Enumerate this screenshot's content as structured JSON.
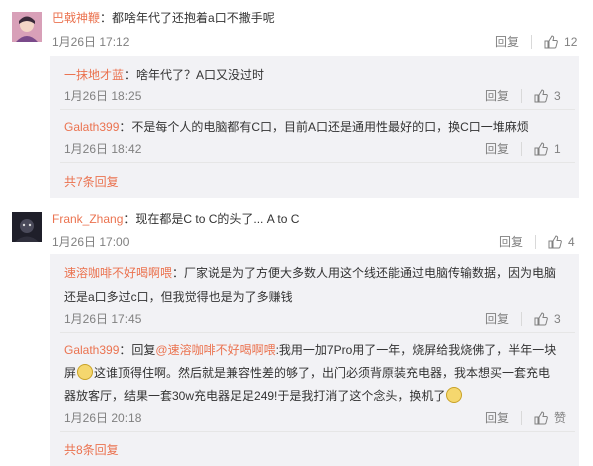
{
  "comments": [
    {
      "name": "巴戟神鞭",
      "text": "：都啥年代了还抱着a口不撒手呢",
      "time": "1月26日 17:12",
      "reply_label": "回复",
      "likes": "12",
      "replies": [
        {
          "name": "一抹地才蓝",
          "text": "：啥年代了？A口又没过时",
          "time": "1月26日 18:25",
          "reply_label": "回复",
          "likes": "3"
        },
        {
          "name": "Galath399",
          "text": "：不是每个人的电脑都有C口，目前A口还是通用性最好的口，换C口一堆麻烦",
          "time": "1月26日 18:42",
          "reply_label": "回复",
          "likes": "1"
        }
      ],
      "more_label": "共7条回复"
    },
    {
      "name": "Frank_Zhang",
      "text": "：现在都是C to C的头了... A to C",
      "time": "1月26日 17:00",
      "reply_label": "回复",
      "likes": "4",
      "replies": [
        {
          "name": "速溶咖啡不好喝啊喂",
          "text_line1": "：厂家说是为了方便大多数人用这个线还能通过电脑传输数据，因为电脑",
          "text_line2": "还是a口多过c口，但我觉得也是为了多赚钱",
          "time": "1月26日 17:45",
          "reply_label": "回复",
          "likes": "3"
        },
        {
          "name": "Galath399",
          "text_prefix": "：回复",
          "mention": "@速溶咖啡不好喝啊喂",
          "text_line1": ":我用一加7Pro用了一年，烧屏给我烧佛了，半年一块",
          "text_line2a": "屏",
          "text_line2b": "这谁顶得住啊。然后就是兼容性差的够了，出门必须背原装充电器，我本想买一套充电",
          "text_line3": "器放客厅，结果一套30w充电器足足249!于是我打消了这个念头，换机了",
          "time": "1月26日 20:18",
          "reply_label": "回复",
          "likes": "赞"
        }
      ],
      "more_label": "共8条回复"
    }
  ]
}
